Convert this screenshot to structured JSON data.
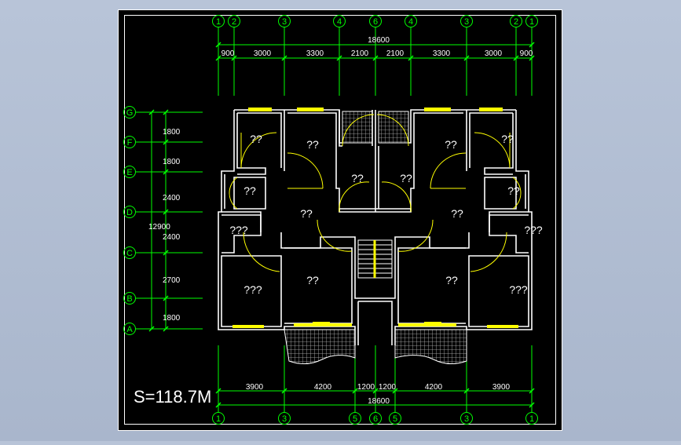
{
  "colors": {
    "background": "#000000",
    "frame": "#ffffff",
    "grid": "#00ff00",
    "wall": "#ffffff",
    "window": "#ffff00",
    "door": "#ffff00",
    "hatch": "#c8c8c8",
    "text": "#ffffff"
  },
  "top_axes": [
    "1",
    "2",
    "3",
    "4",
    "6",
    "4",
    "3",
    "2",
    "1"
  ],
  "bottom_axes": [
    "1",
    "3",
    "5",
    "6",
    "5",
    "3",
    "1"
  ],
  "left_axes": [
    "G",
    "F",
    "E",
    "D",
    "C",
    "B",
    "A"
  ],
  "top_total": "18600",
  "top_dims": [
    "900",
    "3000",
    "3300",
    "2100",
    "2100",
    "3300",
    "3000",
    "900"
  ],
  "bottom_total": "18600",
  "bottom_dims": [
    "3900",
    "4200",
    "1200",
    "1200",
    "4200",
    "3900"
  ],
  "left_dims": [
    "1800",
    "1800",
    "2400",
    "2400",
    "2700",
    "1800"
  ],
  "left_total": "12900",
  "room_labels": [
    "??",
    "??",
    "??",
    "??",
    "??",
    "??",
    "??",
    "??",
    "??",
    "??",
    "???",
    "???",
    "??",
    "??",
    "???",
    "???",
    "??",
    "??"
  ],
  "area_label": "S=118.7M"
}
